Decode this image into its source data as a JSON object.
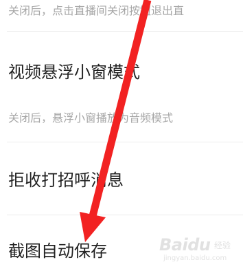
{
  "settings": {
    "items": [
      {
        "description": "关闭后，点击直播间关闭按钮退出直"
      },
      {
        "title": "视频悬浮小窗模式",
        "description": "关闭后，悬浮小窗播放为音频模式"
      },
      {
        "title": "拒收打招呼消息"
      },
      {
        "title": "截图自动保存"
      }
    ]
  },
  "annotation": {
    "arrow_color": "#f22222"
  },
  "watermark": {
    "logo": "Baidu",
    "sub": "经验",
    "url": "jingyan.baidu.com"
  }
}
